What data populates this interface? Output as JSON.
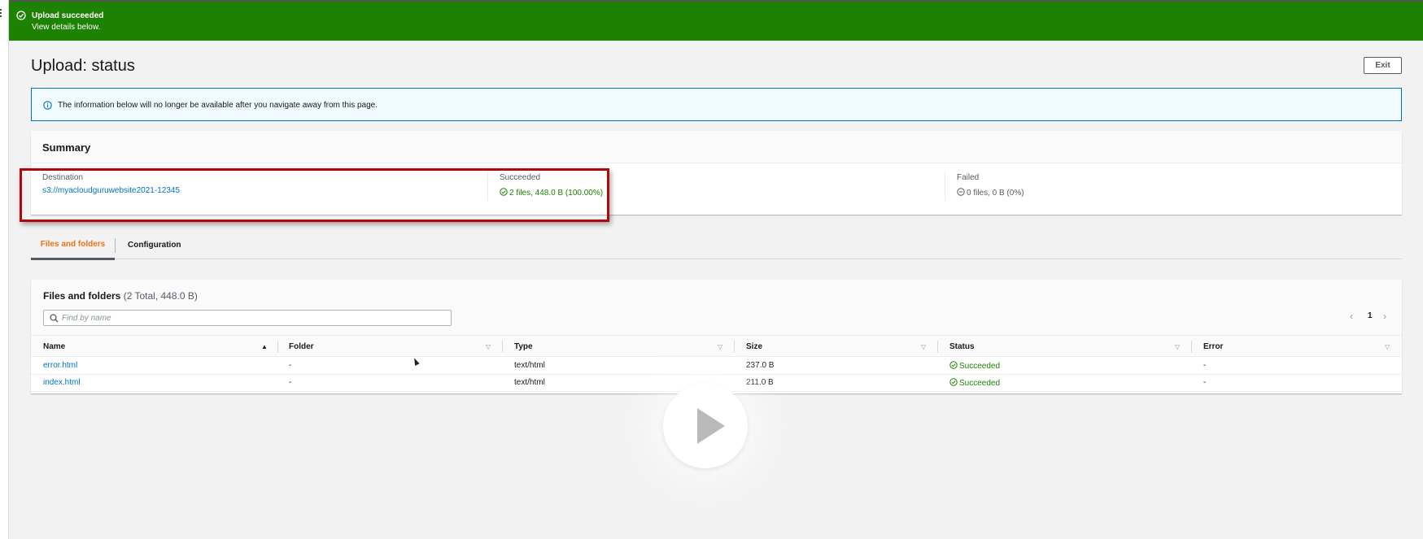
{
  "flash": {
    "title": "Upload succeeded",
    "subtitle": "View details below.",
    "icon": "check-circle-icon",
    "color": "#1d8102"
  },
  "page": {
    "title": "Upload: status",
    "exit_label": "Exit"
  },
  "alert": {
    "icon": "info-icon",
    "message": "The information below will no longer be available after you navigate away from this page."
  },
  "summary": {
    "heading": "Summary",
    "destination_label": "Destination",
    "destination_value": "s3://myacloudguruwebsite2021-12345",
    "succeeded_label": "Succeeded",
    "succeeded_value": "2 files, 448.0 B (100.00%)",
    "failed_label": "Failed",
    "failed_value": "0 files, 0 B (0%)"
  },
  "tabs": [
    {
      "label": "Files and folders",
      "active": true
    },
    {
      "label": "Configuration",
      "active": false
    }
  ],
  "files": {
    "heading": "Files and folders",
    "count": "(2 Total, 448.0 B)",
    "search_placeholder": "Find by name",
    "page": "1",
    "columns": [
      "Name",
      "Folder",
      "Type",
      "Size",
      "Status",
      "Error"
    ],
    "rows": [
      {
        "name": "error.html",
        "folder": "-",
        "type": "text/html",
        "size": "237.0 B",
        "status": "Succeeded",
        "error": "-"
      },
      {
        "name": "index.html",
        "folder": "-",
        "type": "text/html",
        "size": "211.0 B",
        "status": "Succeeded",
        "error": "-"
      }
    ]
  },
  "colors": {
    "success": "#1d8102",
    "link": "#0073bb",
    "highlight_box": "#b2060e",
    "active_tab": "#ec7211"
  }
}
